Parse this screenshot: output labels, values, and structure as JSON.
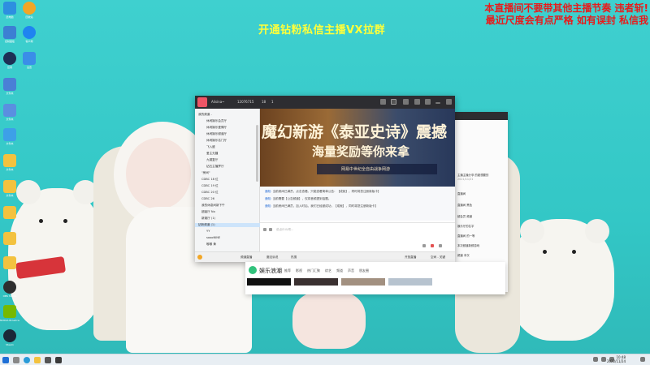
{
  "overlay": {
    "headline": "开通钻粉私信主播VX拉群",
    "notice_line1": "本直播间不要带其他主播节奏 违者斩!",
    "notice_line2": "最近尺度会有点严格 如有误封 私信我"
  },
  "chat_window": {
    "topbar": {
      "name": "Alisina~",
      "count": "12076715",
      "stat_a": "18",
      "stat_b": "1"
    },
    "sidebar": {
      "header": "我的频道 -",
      "items": [
        "休闲娱乐会员厅",
        "休闲娱乐爱情厅",
        "休闲娱乐频道厅",
        "休闲娱乐名门厅",
        "飞入盛",
        "爱主无疆",
        "九嫂复厅",
        "钻石主播梦厅",
        "\"房间\"",
        "CDBC 18 位",
        "CDBC 19 位",
        "CDBC 20 位",
        "CDBC 26",
        "我的休息间新下午",
        "超级厅 No",
        "新娱厅 (1)",
        "钻粉频道 (1)",
        "YY",
        "soooNINE",
        "嘟嘟 黄",
        "专业放置 (1)",
        "频道",
        "频道会客厅 (11)"
      ]
    },
    "banner": {
      "title": "魔幻新游《泰亚史诗》震撼",
      "subtitle": "海量奖励等你来拿",
      "strip": "网易中世纪全自由战争网游"
    },
    "chat_lines": [
      {
        "lead": "通知:",
        "text": "当前房间已满员，点击查看。只能查看简单公告：【成就】，同时将您注册新版卡】"
      },
      {
        "lead": "通知:",
        "text": "当前需要【公告频道】，仅将音频提到话题。"
      },
      {
        "lead": "通知:",
        "text": "当前房间已满员，加入时后，我们已经被成功，【成就】，同时将您注册新版卡】"
      }
    ],
    "input_placeholder": "说点什么吧...",
    "bottom_bar": {
      "items": [
        "频道直播",
        "魔法诉说",
        "热搜"
      ],
      "right_items": [
        "开放直播",
        "空间 - 关键"
      ]
    }
  },
  "right_panel": {
    "lines": [
      {
        "title": "主播主播分享 的超想要的",
        "sub": "2021/11/21"
      },
      {
        "title": "直播间",
        "sub": ""
      },
      {
        "title": "直播间 黑色",
        "sub": ""
      },
      {
        "title": "超会员 频道",
        "sub": ""
      },
      {
        "title": "娱乐厅的名字",
        "sub": ""
      },
      {
        "title": "直播间 的一等",
        "sub": ""
      },
      {
        "title": "本次频道新鲜游戏",
        "sub": ""
      },
      {
        "title": "频道 本次",
        "sub": ""
      },
      {
        "title": "超级厅 主播",
        "sub": ""
      },
      {
        "title": "一 BNITIO",
        "sub": ""
      }
    ]
  },
  "browser": {
    "title": "娱乐浪潮",
    "tabs": [
      "推荐",
      "影视",
      "热门汇聚",
      "综艺",
      "频道",
      "声音",
      "朋友圈"
    ]
  },
  "taskbar": {
    "time": "10:48",
    "date": "2022/11/24"
  },
  "desktop_icons": [
    "此电脑",
    "回收站",
    "控制面板",
    "客户端",
    "应用",
    "设置",
    "文件夹",
    "文件夹",
    "文件夹",
    "文件夹",
    "文件夹",
    "OBS Studio",
    "NVIDIA Broadcast",
    "Steam"
  ]
}
